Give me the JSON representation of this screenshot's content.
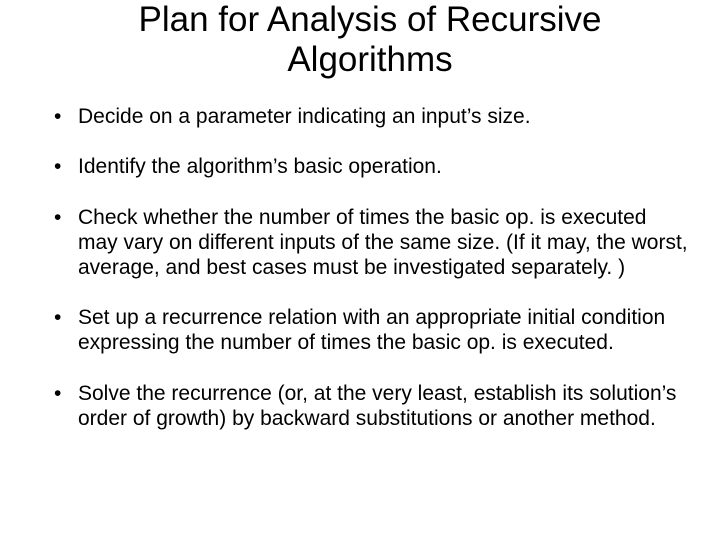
{
  "title": "Plan for Analysis of Recursive Algorithms",
  "bullets": [
    "Decide on  a parameter indicating an input’s size.",
    "Identify the algorithm’s basic operation.",
    "Check whether the number of times the basic op. is executed may vary on different inputs of the same size.  (If it may, the worst, average, and best cases must be investigated separately. )",
    "Set up a recurrence relation with an appropriate initial condition expressing the number of times the basic op. is executed.",
    "Solve the recurrence (or, at the very least, establish its solution’s order of growth) by backward substitutions or another method."
  ]
}
